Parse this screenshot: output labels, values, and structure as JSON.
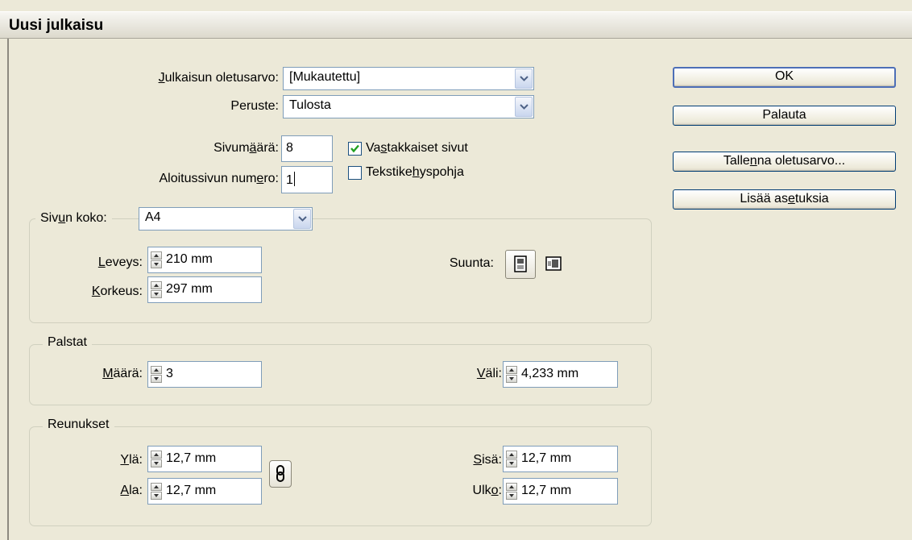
{
  "window": {
    "title": "Uusi julkaisu"
  },
  "preset": {
    "label_u": "J",
    "label_rest": "ulkaisun oletusarvo:",
    "value": "[Mukautettu]"
  },
  "intent": {
    "label": "Peruste:",
    "value": "Tulosta"
  },
  "pages": {
    "label_a": "Sivum",
    "label_u": "ä",
    "label_b": "ärä:",
    "value": "8"
  },
  "start_page": {
    "label_a": "Aloitussivun num",
    "label_u": "e",
    "label_b": "ro:",
    "value": "1"
  },
  "facing_pages": {
    "label_a": "Va",
    "label_u": "s",
    "label_b": "takkaiset sivut",
    "checked": true
  },
  "master_text_frame": {
    "label_a": "Tekstike",
    "label_u": "h",
    "label_b": "yspohja",
    "checked": false
  },
  "page_size": {
    "label_a": "Siv",
    "label_u": "u",
    "label_b": "n koko:",
    "value": "A4",
    "width_label_u": "L",
    "width_label_rest": "eveys:",
    "width": "210 mm",
    "height_label_u": "K",
    "height_label_rest": "orkeus:",
    "height": "297 mm",
    "orientation_label": "Suunta:"
  },
  "columns": {
    "legend": "Palstat",
    "number_label_u": "M",
    "number_label_rest": "äärä:",
    "number": "3",
    "gutter_label_u": "V",
    "gutter_label_rest": "äli:",
    "gutter": "4,233 mm"
  },
  "margins": {
    "legend": "Reunukset",
    "top_label_u": "Y",
    "top_label_rest": "lä:",
    "top": "12,7 mm",
    "bottom_label_u": "A",
    "bottom_label_rest": "la:",
    "bottom": "12,7 mm",
    "inside_label_u": "S",
    "inside_label_rest": "isä:",
    "inside": "12,7 mm",
    "outside_label_a": "Ulk",
    "outside_label_u": "o",
    "outside_label_b": ":",
    "outside": "12,7 mm"
  },
  "buttons": {
    "ok": "OK",
    "reset": "Palauta",
    "save_a": "Talle",
    "save_u": "n",
    "save_b": "na oletusarvo...",
    "more_a": "Lisää as",
    "more_u": "e",
    "more_b": "tuksia"
  }
}
